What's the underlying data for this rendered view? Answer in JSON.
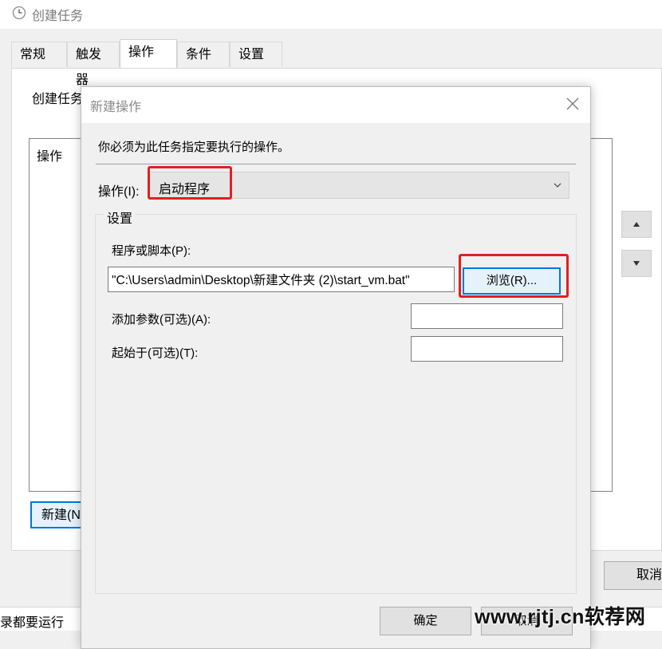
{
  "background_window": {
    "title": "创建任务",
    "tabs": [
      {
        "label": "常规"
      },
      {
        "label": "触发器"
      },
      {
        "label": "操作"
      },
      {
        "label": "条件"
      },
      {
        "label": "设置"
      }
    ],
    "active_tab": "操作",
    "description": "创建任务",
    "actions_column_header": "操作",
    "new_button_label": "新建(N",
    "cancel_button_label": "取消",
    "status_text": "录都要运行"
  },
  "dialog": {
    "title": "新建操作",
    "instruction": "你必须为此任务指定要执行的操作。",
    "action_label": "操作(I):",
    "action_value": "启动程序",
    "settings_group_label": "设置",
    "program_label": "程序或脚本(P):",
    "program_value": "\"C:\\Users\\admin\\Desktop\\新建文件夹 (2)\\start_vm.bat\"",
    "browse_label": "浏览(R)...",
    "arguments_label": "添加参数(可选)(A):",
    "arguments_value": "",
    "start_in_label": "起始于(可选)(T):",
    "start_in_value": "",
    "ok_label": "确定",
    "cancel_label": "取消"
  },
  "annotations": {
    "highlight_color": "#e02020"
  },
  "watermark": "www.rjtj.cn软荐网",
  "colors": {
    "accent": "#0078d7",
    "window_bg": "#f0f0f0",
    "button_bg": "#e1e1e1"
  }
}
